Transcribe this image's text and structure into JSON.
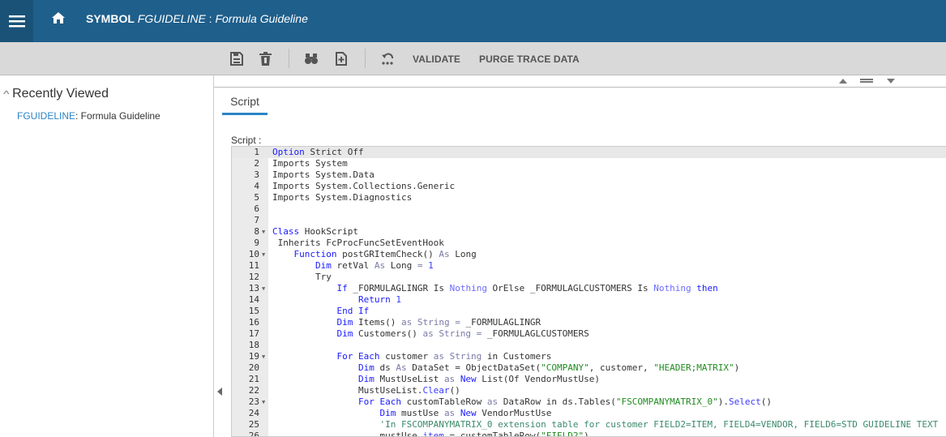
{
  "header": {
    "symbol": "SYMBOL",
    "code": "FGUIDELINE",
    "separator": " : ",
    "name": "Formula Guideline"
  },
  "toolbar": {
    "validate": "VALIDATE",
    "purge": "PURGE TRACE DATA"
  },
  "sidebar": {
    "title": "Recently Viewed",
    "items": [
      {
        "code": "FGUIDELINE",
        "name": ": Formula Guideline"
      }
    ]
  },
  "tabs": [
    {
      "label": "Script"
    }
  ],
  "script_label": "Script :",
  "colors": {
    "header": "#1f5f8b",
    "accent": "#2b84c6"
  },
  "code_lines": [
    {
      "n": "1",
      "f": false,
      "t": [
        [
          "k",
          "Option"
        ],
        [
          "t",
          " Strict Off"
        ]
      ]
    },
    {
      "n": "2",
      "f": false,
      "t": [
        [
          "t",
          "Imports System"
        ]
      ]
    },
    {
      "n": "3",
      "f": false,
      "t": [
        [
          "t",
          "Imports System.Data"
        ]
      ]
    },
    {
      "n": "4",
      "f": false,
      "t": [
        [
          "t",
          "Imports System.Collections.Generic"
        ]
      ]
    },
    {
      "n": "5",
      "f": false,
      "t": [
        [
          "t",
          "Imports System.Diagnostics"
        ]
      ]
    },
    {
      "n": "6",
      "f": false,
      "t": []
    },
    {
      "n": "7",
      "f": false,
      "t": []
    },
    {
      "n": "8",
      "f": true,
      "t": [
        [
          "k",
          "Class"
        ],
        [
          "t",
          " HookScript"
        ]
      ]
    },
    {
      "n": "9",
      "f": false,
      "t": [
        [
          "t",
          " Inherits FcProcFuncSetEventHook"
        ]
      ]
    },
    {
      "n": "10",
      "f": true,
      "t": [
        [
          "t",
          "    "
        ],
        [
          "k",
          "Function"
        ],
        [
          "t",
          " postGRItemCheck() "
        ],
        [
          "a",
          "As"
        ],
        [
          "t",
          " Long"
        ]
      ]
    },
    {
      "n": "11",
      "f": false,
      "t": [
        [
          "t",
          "        "
        ],
        [
          "k",
          "Dim"
        ],
        [
          "t",
          " retVal "
        ],
        [
          "a",
          "As"
        ],
        [
          "t",
          " Long "
        ],
        [
          "a",
          "="
        ],
        [
          "t",
          " "
        ],
        [
          "m",
          "1"
        ]
      ]
    },
    {
      "n": "12",
      "f": false,
      "t": [
        [
          "t",
          "        Try"
        ]
      ]
    },
    {
      "n": "13",
      "f": true,
      "t": [
        [
          "t",
          "            "
        ],
        [
          "k",
          "If"
        ],
        [
          "t",
          " _FORMULAGLINGR Is "
        ],
        [
          "n",
          "Nothing"
        ],
        [
          "t",
          " OrElse _FORMULAGLCUSTOMERS Is "
        ],
        [
          "n",
          "Nothing"
        ],
        [
          "t",
          " "
        ],
        [
          "k",
          "then"
        ]
      ]
    },
    {
      "n": "14",
      "f": false,
      "t": [
        [
          "t",
          "                "
        ],
        [
          "k",
          "Return"
        ],
        [
          "t",
          " "
        ],
        [
          "m",
          "1"
        ]
      ]
    },
    {
      "n": "15",
      "f": false,
      "t": [
        [
          "t",
          "            "
        ],
        [
          "k",
          "End If"
        ]
      ]
    },
    {
      "n": "16",
      "f": false,
      "t": [
        [
          "t",
          "            "
        ],
        [
          "k",
          "Dim"
        ],
        [
          "t",
          " Items() "
        ],
        [
          "a",
          "as String ="
        ],
        [
          "t",
          " _FORMULAGLINGR"
        ]
      ]
    },
    {
      "n": "17",
      "f": false,
      "t": [
        [
          "t",
          "            "
        ],
        [
          "k",
          "Dim"
        ],
        [
          "t",
          " Customers() "
        ],
        [
          "a",
          "as String ="
        ],
        [
          "t",
          " _FORMULAGLCUSTOMERS"
        ]
      ]
    },
    {
      "n": "18",
      "f": false,
      "t": []
    },
    {
      "n": "19",
      "f": true,
      "t": [
        [
          "t",
          "            "
        ],
        [
          "k",
          "For Each"
        ],
        [
          "t",
          " customer "
        ],
        [
          "a",
          "as String"
        ],
        [
          "t",
          " in Customers"
        ]
      ]
    },
    {
      "n": "20",
      "f": false,
      "t": [
        [
          "t",
          "                "
        ],
        [
          "k",
          "Dim"
        ],
        [
          "t",
          " ds "
        ],
        [
          "a",
          "As"
        ],
        [
          "t",
          " DataSet = ObjectDataSet("
        ],
        [
          "s",
          "\"COMPANY\""
        ],
        [
          "t",
          ", customer, "
        ],
        [
          "s",
          "\"HEADER;MATRIX\""
        ],
        [
          "t",
          ")"
        ]
      ]
    },
    {
      "n": "21",
      "f": false,
      "t": [
        [
          "t",
          "                "
        ],
        [
          "k",
          "Dim"
        ],
        [
          "t",
          " MustUseList "
        ],
        [
          "a",
          "as"
        ],
        [
          "t",
          " "
        ],
        [
          "k",
          "New"
        ],
        [
          "t",
          " List(Of VendorMustUse)"
        ]
      ]
    },
    {
      "n": "22",
      "f": false,
      "t": [
        [
          "t",
          "                MustUseList."
        ],
        [
          "m",
          "Clear"
        ],
        [
          "t",
          "()"
        ]
      ]
    },
    {
      "n": "23",
      "f": true,
      "t": [
        [
          "t",
          "                "
        ],
        [
          "k",
          "For Each"
        ],
        [
          "t",
          " customTableRow "
        ],
        [
          "a",
          "as"
        ],
        [
          "t",
          " DataRow in ds.Tables("
        ],
        [
          "s",
          "\"FSCOMPANYMATRIX_0\""
        ],
        [
          "t",
          ")."
        ],
        [
          "m",
          "Select"
        ],
        [
          "t",
          "()"
        ]
      ]
    },
    {
      "n": "24",
      "f": false,
      "t": [
        [
          "t",
          "                    "
        ],
        [
          "k",
          "Dim"
        ],
        [
          "t",
          " mustUse "
        ],
        [
          "a",
          "as"
        ],
        [
          "t",
          " "
        ],
        [
          "k",
          "New"
        ],
        [
          "t",
          " VendorMustUse"
        ]
      ]
    },
    {
      "n": "25",
      "f": false,
      "t": [
        [
          "t",
          "                    "
        ],
        [
          "c",
          "'In FSCOMPANYMATRIX_0 extension table for customer FIELD2=ITEM, FIELD4=VENDOR, FIELD6=STD GUIDELINE TEXT"
        ]
      ]
    },
    {
      "n": "26",
      "f": false,
      "t": [
        [
          "t",
          "                    mustUse."
        ],
        [
          "m",
          "item"
        ],
        [
          "t",
          " = customTableRow("
        ],
        [
          "s",
          "\"FIELD2\""
        ],
        [
          "t",
          ")"
        ]
      ]
    }
  ]
}
